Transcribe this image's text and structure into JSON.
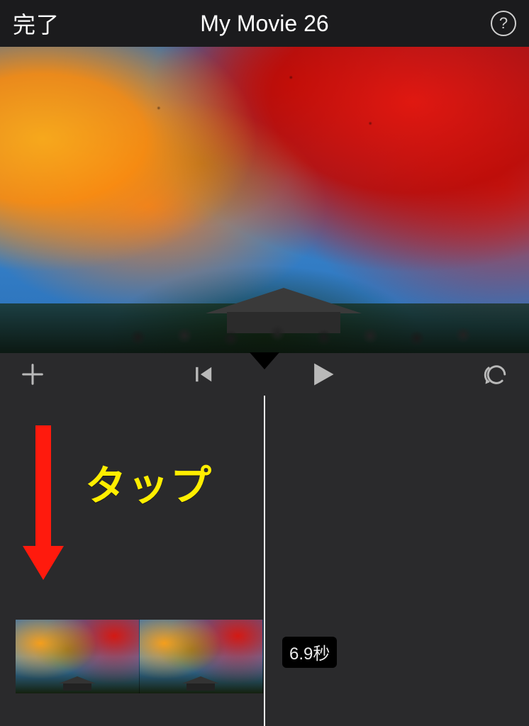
{
  "header": {
    "done_label": "完了",
    "title": "My Movie 26",
    "help_label": "?"
  },
  "toolbar": {
    "add_name": "add-media-button",
    "start_name": "skip-to-start-button",
    "play_name": "play-button",
    "undo_name": "undo-button"
  },
  "timeline": {
    "clip_duration": "6.9秒"
  },
  "annotation": {
    "text": "タップ"
  }
}
